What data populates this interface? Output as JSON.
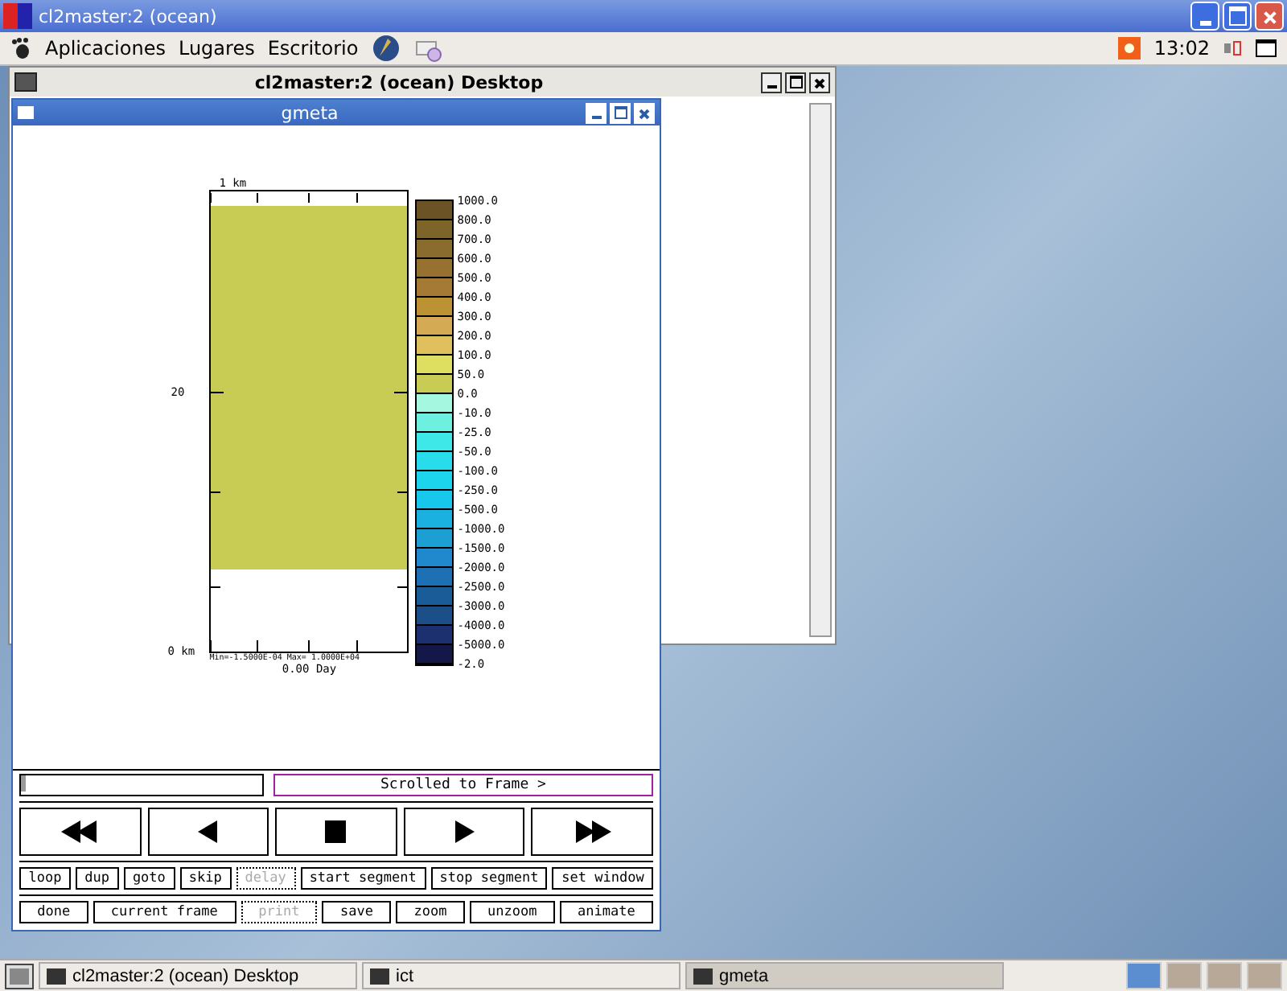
{
  "vnc_window": {
    "title": "cl2master:2 (ocean)"
  },
  "panel": {
    "menus": [
      "Aplicaciones",
      "Lugares",
      "Escritorio"
    ],
    "clock": "13:02"
  },
  "desktop_window": {
    "title": "cl2master:2 (ocean) Desktop"
  },
  "gmeta": {
    "title": "gmeta",
    "plot": {
      "top_label": "1 km",
      "mid_label": "20",
      "bottom_label": "0 km",
      "range_text": "Min=-1.5000E-04  Max= 1.0000E+04",
      "time_text": "0.00 Day"
    },
    "legend": {
      "entries": [
        {
          "color": "#6b5326",
          "label": "1000.0"
        },
        {
          "color": "#7d6428",
          "label": "800.0"
        },
        {
          "color": "#8a6c2e",
          "label": "700.0"
        },
        {
          "color": "#97712f",
          "label": "600.0"
        },
        {
          "color": "#a57a35",
          "label": "500.0"
        },
        {
          "color": "#bc9233",
          "label": "400.0"
        },
        {
          "color": "#d4aa55",
          "label": "300.0"
        },
        {
          "color": "#e0c05c",
          "label": "200.0"
        },
        {
          "color": "#dede60",
          "label": "100.0"
        },
        {
          "color": "#c8cc55",
          "label": "50.0"
        },
        {
          "color": "#a5f7e0",
          "label": "0.0"
        },
        {
          "color": "#6ef0e0",
          "label": "-10.0"
        },
        {
          "color": "#3ee8e8",
          "label": "-25.0"
        },
        {
          "color": "#28dcec",
          "label": "-50.0"
        },
        {
          "color": "#1cd4ec",
          "label": "-100.0"
        },
        {
          "color": "#18c8ec",
          "label": "-250.0"
        },
        {
          "color": "#1ab0e0",
          "label": "-500.0"
        },
        {
          "color": "#1ca0d4",
          "label": "-1000.0"
        },
        {
          "color": "#2088cc",
          "label": "-1500.0"
        },
        {
          "color": "#1e70b4",
          "label": "-2000.0"
        },
        {
          "color": "#1a5c98",
          "label": "-2500.0"
        },
        {
          "color": "#1c4e88",
          "label": "-3000.0"
        },
        {
          "color": "#1c3070",
          "label": "-4000.0"
        },
        {
          "color": "#141848",
          "label": "-5000.0"
        }
      ],
      "end_label": "-2.0"
    },
    "status": "Scrolled to Frame  >",
    "transport": [
      {
        "kind": "rewind"
      },
      {
        "kind": "back"
      },
      {
        "kind": "stop"
      },
      {
        "kind": "play"
      },
      {
        "kind": "forward"
      }
    ],
    "row1": [
      {
        "label": "loop",
        "disabled": false
      },
      {
        "label": "dup",
        "disabled": false
      },
      {
        "label": "goto",
        "disabled": false
      },
      {
        "label": "skip",
        "disabled": false
      },
      {
        "label": "delay",
        "disabled": true
      },
      {
        "label": "start segment",
        "disabled": false
      },
      {
        "label": "stop segment",
        "disabled": false
      },
      {
        "label": "set window",
        "disabled": false
      }
    ],
    "row2": [
      {
        "label": "done",
        "disabled": false
      },
      {
        "label": "current frame",
        "disabled": false
      },
      {
        "label": "print",
        "disabled": true
      },
      {
        "label": "save",
        "disabled": false
      },
      {
        "label": "zoom",
        "disabled": false
      },
      {
        "label": "unzoom",
        "disabled": false
      },
      {
        "label": "animate",
        "disabled": false
      }
    ]
  },
  "taskbar": [
    {
      "label": "cl2master:2 (ocean) Desktop",
      "selected": false
    },
    {
      "label": "ict",
      "selected": false
    },
    {
      "label": "gmeta",
      "selected": true
    }
  ],
  "workspaces": [
    {
      "selected": true
    },
    {
      "selected": false
    },
    {
      "selected": false
    },
    {
      "selected": false
    }
  ]
}
